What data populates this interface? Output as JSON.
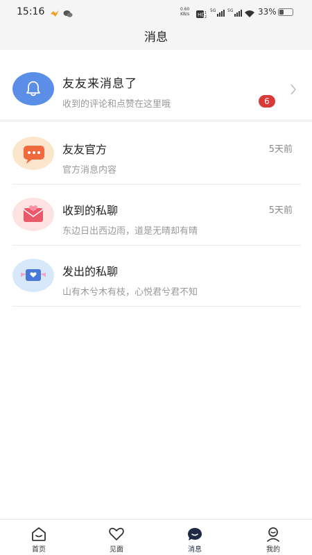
{
  "status_bar": {
    "time": "15:16",
    "net_speed_value": "0.60",
    "net_speed_unit": "KB/s",
    "battery": "33%"
  },
  "header": {
    "title": "消息"
  },
  "notification": {
    "title": "友友来消息了",
    "subtitle": "收到的评论和点赞在这里哦",
    "badge_count": "6"
  },
  "messages": [
    {
      "title": "友友官方",
      "subtitle": "官方消息内容",
      "time": "5天前",
      "icon": "chat-bubble-icon"
    },
    {
      "title": "收到的私聊",
      "subtitle": "东边日出西边雨，道是无晴却有晴",
      "time": "5天前",
      "icon": "envelope-heart-icon"
    },
    {
      "title": "发出的私聊",
      "subtitle": "山有木兮木有枝，心悦君兮君不知",
      "time": "",
      "icon": "winged-heart-letter-icon"
    }
  ],
  "tabs": [
    {
      "label": "首页",
      "icon": "home-icon",
      "active": false
    },
    {
      "label": "见面",
      "icon": "heart-icon",
      "active": false
    },
    {
      "label": "消息",
      "icon": "message-icon",
      "active": true
    },
    {
      "label": "我的",
      "icon": "profile-icon",
      "active": false
    }
  ],
  "colors": {
    "accent": "#5b8ee6",
    "badge": "#d93a3a",
    "active_tab": "#1f2a44"
  }
}
